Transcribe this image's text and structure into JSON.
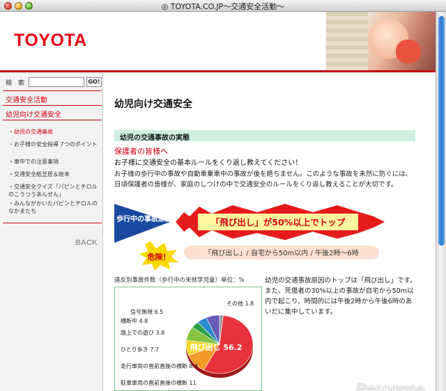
{
  "window": {
    "title": "◎ TOYOTA.CO.JP〜交通安全活動〜"
  },
  "header": {
    "logo": "TOYOTA"
  },
  "search": {
    "label": "検　索",
    "go": "GO!"
  },
  "sidebar": {
    "nav": [
      "交通安全活動",
      "幼児向け交通安全"
    ],
    "items": [
      "・幼児の交通事故",
      "・お子様の安全指導 7つのポイント",
      "・車中での注意事項",
      "・交通安全紙芝居＆絵本",
      "・交通安全クイズ「パピンとチロルのこうつうあんぜん」",
      "・みんながかいたパピンとチロルのなかまたち"
    ],
    "back": "BACK"
  },
  "main": {
    "title": "幼児向け交通安全",
    "section": "幼児の交通事故の実態",
    "subhead": "保護者の皆様へ",
    "lead": "お子様に交通安全の基本ルールをくり返し教えてください！",
    "para": "お子様の歩行中の事故や自動車乗車中の事故が後を絶ちません。このような事故を未然に防ぐには、日頃保護者の皆様が、家庭のしつけの中で交通安全のルールをくり返し教えることが大切です。",
    "banner": {
      "arrow": "歩行中の事故原因",
      "headline": "「飛び出し」が50%以上でトップ",
      "danger": "危険！",
      "detail": "「飛び出し」/ 自宅から50m以内 / 午後2時〜6時"
    },
    "chart_caption": "違反別事故件数（歩行中の未就学児童）単位：%",
    "right_text": "幼児の交通事故原因のトップは「飛び出し」です。また、死傷者の30%以上の事故が自宅から50m以内で起こり、時間的には午後2時から午後6時のあいだに集中しています。"
  },
  "chart_data": {
    "type": "pie",
    "title": "違反別事故件数（歩行中の未就学児童）単位：%",
    "slices": [
      {
        "label": "飛び出し",
        "value": 56.2,
        "color": "#e8323c"
      },
      {
        "label": "駐車車両の直前直後の横断",
        "value": 11.0,
        "color": "#f29a28"
      },
      {
        "label": "走行車両の直前直後の横断",
        "value": 8.4,
        "color": "#f4d62a"
      },
      {
        "label": "ひとり歩き",
        "value": 7.7,
        "color": "#86c440"
      },
      {
        "label": "路上での遊び",
        "value": 3.8,
        "color": "#2aa24a"
      },
      {
        "label": "横断中",
        "value": 4.8,
        "color": "#2c8ad0"
      },
      {
        "label": "信号無視",
        "value": 6.5,
        "color": "#6a5ab8"
      },
      {
        "label": "その他",
        "value": 1.8,
        "color": "#9a9a9a"
      }
    ]
  },
  "watermark": "Response."
}
